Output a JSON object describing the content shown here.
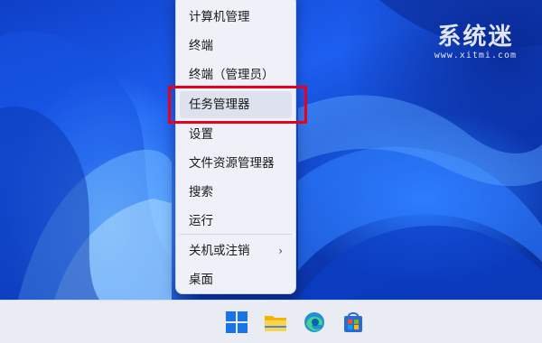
{
  "context_menu": {
    "items": [
      {
        "label": "计算机管理"
      },
      {
        "label": "终端"
      },
      {
        "label": "终端（管理员）"
      },
      {
        "label": "任务管理器"
      },
      {
        "label": "设置"
      },
      {
        "label": "文件资源管理器"
      },
      {
        "label": "搜索"
      },
      {
        "label": "运行"
      },
      {
        "label": "关机或注销",
        "has_submenu": true,
        "chevron": "›"
      },
      {
        "label": "桌面"
      }
    ],
    "highlighted_item": "任务管理器",
    "highlight_color": "#e8001c"
  },
  "watermark": {
    "brand": "系统迷",
    "url": "www.xitmi.com"
  },
  "taskbar": {
    "icons": [
      "windows-start-icon",
      "file-explorer-icon",
      "edge-browser-icon",
      "microsoft-store-icon"
    ]
  },
  "colors": {
    "wallpaper_blue": "#1d5ff0",
    "menu_bg": "#eef1f8",
    "taskbar_bg": "#e9edf3"
  }
}
